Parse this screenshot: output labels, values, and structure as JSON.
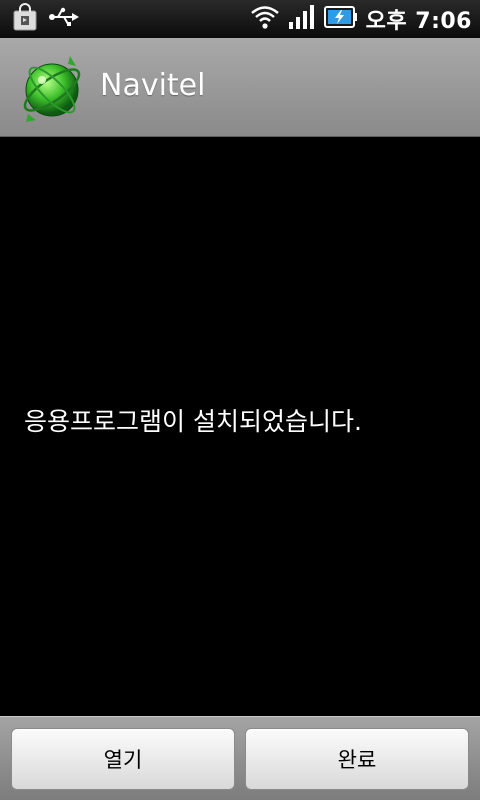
{
  "status_bar": {
    "time": "오후 7:06",
    "icons": [
      "shopping-bag-icon",
      "usb-icon",
      "wifi-icon",
      "signal-icon",
      "battery-charging-icon"
    ]
  },
  "title_bar": {
    "app_name": "Navitel",
    "app_icon": "navitel-globe-icon"
  },
  "message": "응용프로그램이 설치되었습니다.",
  "buttons": {
    "open": "열기",
    "done": "완료"
  },
  "colors": {
    "accent_green": "#3cbf2a",
    "title_bar_bg": "#9a9a9a",
    "battery_blue": "#2f9be6"
  }
}
